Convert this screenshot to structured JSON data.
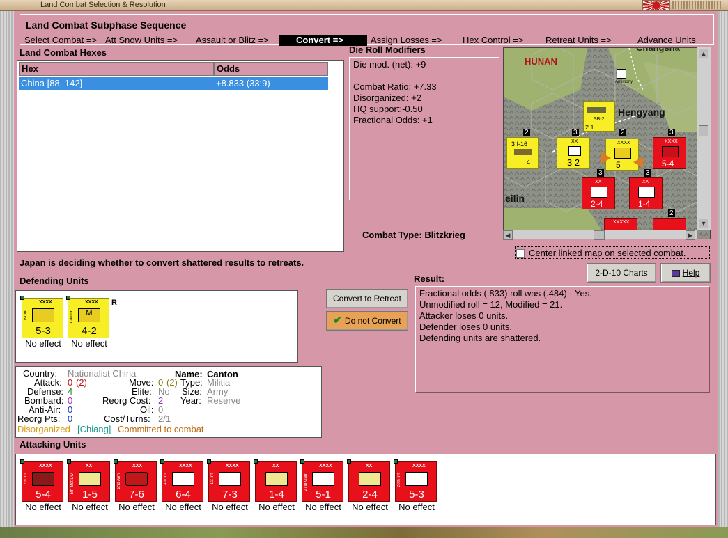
{
  "window": {
    "title": "Land Combat Selection & Resolution"
  },
  "subphase": {
    "title": "Land Combat Subphase Sequence",
    "steps": [
      {
        "label": "Select Combat =>",
        "active": false
      },
      {
        "label": "Att Snow Units =>",
        "active": false
      },
      {
        "label": "Assault or Blitz =>",
        "active": false
      },
      {
        "label": "Convert =>",
        "active": true
      },
      {
        "label": "Assign Losses =>",
        "active": false
      },
      {
        "label": "Hex Control =>",
        "active": false
      },
      {
        "label": "Retreat Units =>",
        "active": false
      },
      {
        "label": "Advance Units",
        "active": false
      }
    ]
  },
  "combat_hexes": {
    "title": "Land Combat Hexes",
    "columns": [
      "Hex",
      "Odds"
    ],
    "rows": [
      [
        "China [88, 142]",
        "+8.833 (33:9)"
      ]
    ]
  },
  "modifiers": {
    "title": "Die Roll Modifiers",
    "lines": [
      "Die mod. (net): +9",
      "",
      "Combat Ratio: +7.33",
      "Disorganized: +2",
      "HQ support:-0.50",
      "Fractional Odds: +1"
    ]
  },
  "combat_type": {
    "label": "Combat Type:",
    "value": "Blitzkrieg"
  },
  "map": {
    "labels": {
      "region": "HUNAN",
      "city": "Hengyang",
      "city2": "eilin",
      "resource": "Antimony",
      "top": "Changsha"
    },
    "stack_numbers": [
      "2",
      "3",
      "2",
      "3",
      "3",
      "3",
      "2"
    ],
    "counters": [
      {
        "txt": "3  I-16",
        "val": "4"
      },
      {
        "txt": "XX",
        "val": "3 2"
      },
      {
        "txt": "XXXX",
        "val": "5"
      },
      {
        "txt": "XXXX",
        "val": "5-4"
      },
      {
        "txt": "XX",
        "val": "2-4"
      },
      {
        "txt": "XX",
        "val": "1-4"
      },
      {
        "txt": "SB-2",
        "val": "2  1"
      },
      {
        "txt": "XXXXX",
        "val": ""
      }
    ]
  },
  "center_linked": {
    "label": "Center linked map on selected combat."
  },
  "status_text": "Japan is deciding whether to convert shattered results to retreats.",
  "buttons": {
    "charts": "2-D-10 Charts",
    "help": "Help",
    "convert_to_retreat": "Convert to Retreat",
    "do_not_convert": "Do not Convert"
  },
  "defending": {
    "title": "Defending Units",
    "units": [
      {
        "name": "1st Inf",
        "cls": "XXXX",
        "str": "5-3",
        "sym": "inf",
        "effect": "No effect",
        "extra": ""
      },
      {
        "name": "Canton",
        "cls": "XXXX",
        "str": "4-2",
        "sym": "mil",
        "effect": "No effect",
        "extra": "R"
      }
    ]
  },
  "unit_info": {
    "country_label": "Country:",
    "country": "Nationalist China",
    "name_label": "Name:",
    "name": "Canton",
    "attack_label": "Attack:",
    "attack": "0",
    "attack_paren": "(2)",
    "move_label": "Move:",
    "move": "0",
    "move_paren": "(2)",
    "type_label": "Type:",
    "type": "Militia",
    "defense_label": "Defense:",
    "defense": "4",
    "elite_label": "Elite:",
    "elite": "No",
    "size_label": "Size:",
    "size": "Army",
    "bombard_label": "Bombard:",
    "bombard": "0",
    "reorg_cost_label": "Reorg Cost:",
    "reorg_cost": "2",
    "year_label": "Year:",
    "year": "Reserve",
    "antiair_label": "Anti-Air:",
    "antiair": "0",
    "oil_label": "Oil:",
    "oil": "0",
    "reorg_pts_label": "Reorg Pts:",
    "reorg_pts": "0",
    "cost_turns_label": "Cost/Turns:",
    "cost_turns": "2/1",
    "status1": "Disorganized",
    "status2": "[Chiang]",
    "status3": "Committed to combat"
  },
  "result": {
    "title": "Result:",
    "lines": [
      "Fractional odds (.833) roll was (.484)  - Yes.",
      "Unmodified roll = 12, Modified = 21.",
      "Attacker loses 0 units.",
      "Defender loses 0 units.",
      "Defending units are shattered."
    ]
  },
  "attacking": {
    "title": "Attacking Units",
    "units": [
      {
        "name": "12th Inf",
        "cls": "XXXX",
        "str": "5-4",
        "sym": "inf-dark",
        "effect": "No effect"
      },
      {
        "name": "5th Mot Div",
        "cls": "XX",
        "str": "1-5",
        "sym": "mot",
        "effect": "No effect"
      },
      {
        "name": "2nd Arm",
        "cls": "XXX",
        "str": "7-6",
        "sym": "arm",
        "effect": "No effect"
      },
      {
        "name": "14th Inf",
        "cls": "XXXX",
        "str": "6-4",
        "sym": "inf",
        "effect": "No effect"
      },
      {
        "name": "1st Inf",
        "cls": "XXXX",
        "str": "7-3",
        "sym": "inf",
        "effect": "No effect"
      },
      {
        "name": "",
        "cls": "XX",
        "str": "1-4",
        "sym": "mot",
        "effect": "No effect"
      },
      {
        "name": "27th Garr",
        "cls": "XXXX",
        "str": "5-1",
        "sym": "garr",
        "effect": "No effect"
      },
      {
        "name": "",
        "cls": "XX",
        "str": "2-4",
        "sym": "mot",
        "effect": "No effect"
      },
      {
        "name": "20th Inf",
        "cls": "XXXX",
        "str": "5-3",
        "sym": "inf",
        "effect": "No effect"
      }
    ]
  },
  "colors": {
    "panel": "#d697a8",
    "active_step": "#000000",
    "selection": "#3a8fe0",
    "jp_red": "#e8101a",
    "cn_yellow": "#f7ee25"
  }
}
